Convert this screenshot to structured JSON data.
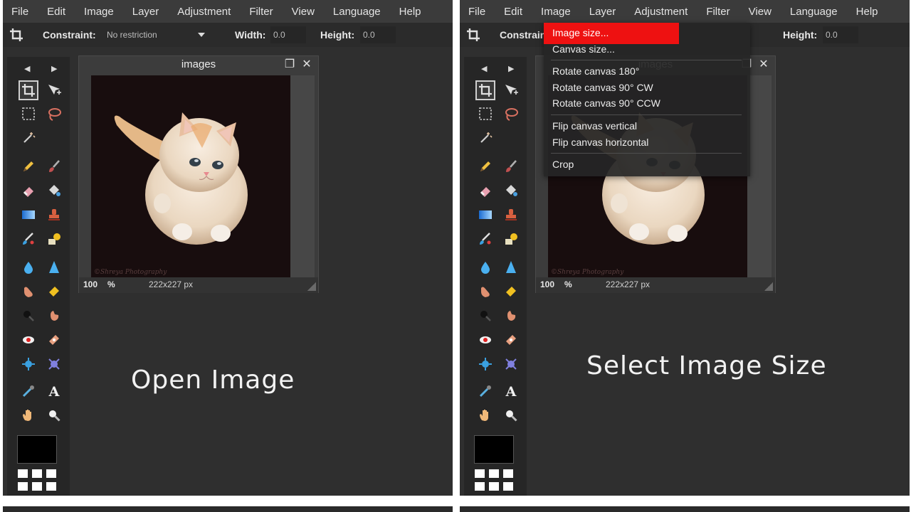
{
  "menu": [
    "File",
    "Edit",
    "Image",
    "Layer",
    "Adjustment",
    "Filter",
    "View",
    "Language",
    "Help"
  ],
  "options": {
    "constraint_label": "Constraint:",
    "constraint_value": "No restriction",
    "width_label": "Width:",
    "width_value": "0.0",
    "height_label": "Height:",
    "height_value": "0.0"
  },
  "image_window": {
    "title": "images",
    "zoom": "100",
    "zoom_unit": "%",
    "dimensions": "222x227 px",
    "watermark": "©Shreya Photography"
  },
  "left_caption": "Open Image",
  "right_caption": "Select Image Size",
  "image_menu": {
    "items": [
      "Image size...",
      "Canvas size...",
      "Rotate canvas 180°",
      "Rotate canvas 90° CW",
      "Rotate canvas 90° CCW",
      "Flip canvas vertical",
      "Flip canvas horizontal",
      "Crop"
    ],
    "active_item": "Image size...",
    "highlight_color": "#ee1111"
  },
  "colors": {
    "panel_bg": "#2f2f2f",
    "menubar_bg": "#3b3b3b",
    "primary_color": "#000000"
  },
  "icons": {
    "tools": [
      "crop-icon",
      "move-icon",
      "marquee-select-icon",
      "lasso-icon",
      "magic-wand-icon",
      "pencil-icon",
      "brush-icon",
      "eraser-icon",
      "paint-bucket-icon",
      "gradient-icon",
      "clone-stamp-icon",
      "color-replace-icon",
      "drawing-icon",
      "blur-icon",
      "sharpen-icon",
      "smudge-icon",
      "sponge-icon",
      "dodge-icon",
      "burn-icon",
      "red-eye-icon",
      "spot-heal-icon",
      "bloat-icon",
      "pinch-icon",
      "color-picker-icon",
      "text-icon",
      "hand-icon",
      "zoom-icon"
    ]
  }
}
